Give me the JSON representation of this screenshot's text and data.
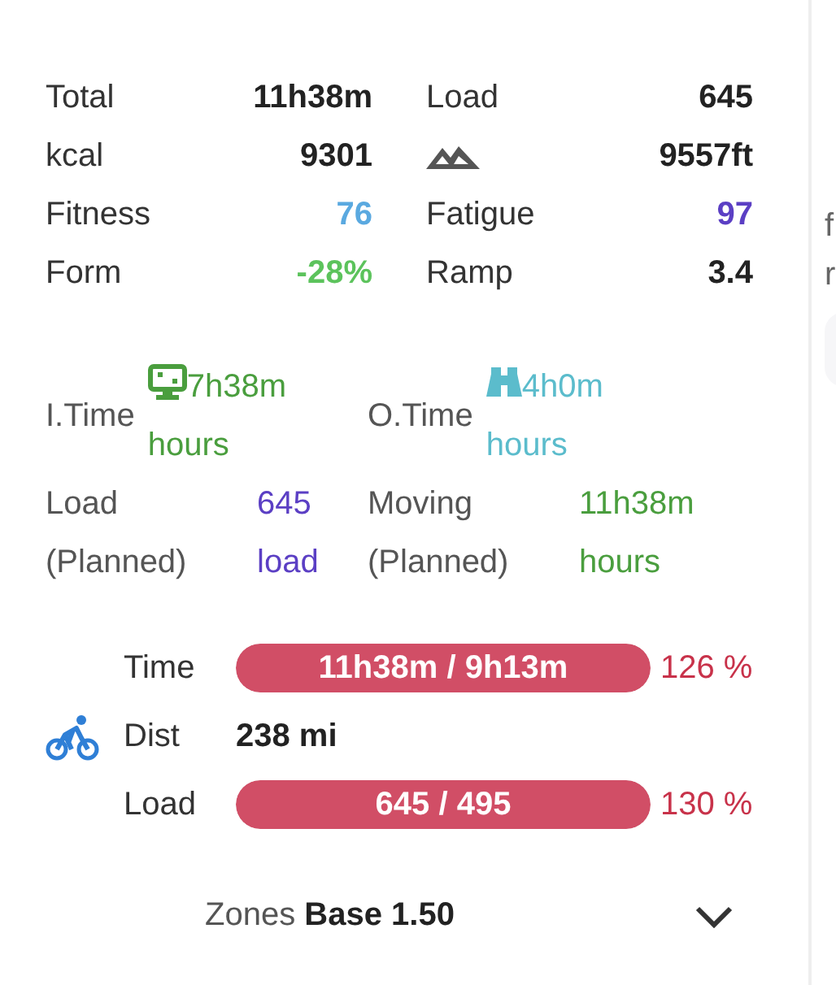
{
  "summary": [
    {
      "label": "Total",
      "kind": "text",
      "value": "11h38m"
    },
    {
      "label": "Load",
      "kind": "text",
      "value": "645"
    },
    {
      "label": "kcal",
      "kind": "text",
      "value": "9301"
    },
    {
      "kind": "elevation",
      "value": "9557ft"
    },
    {
      "label": "Fitness",
      "kind": "text",
      "value": "76",
      "color": "#5aa9e0"
    },
    {
      "label": "Fatigue",
      "kind": "text",
      "value": "97",
      "color": "#5b3fc4"
    },
    {
      "label": "Form",
      "kind": "text",
      "value": "-28%",
      "color": "#5cc35c"
    },
    {
      "label": "Ramp",
      "kind": "text",
      "value": "3.4"
    }
  ],
  "times": [
    {
      "label": "I.Time",
      "kind": "indoor",
      "value": "7h38m",
      "unit": "hours",
      "color": "#4a9e3e"
    },
    {
      "label": "O.Time",
      "kind": "outdoor",
      "value": "4h0m",
      "unit": "hours",
      "color": "#5bbccc"
    },
    {
      "label": "Load (Planned)",
      "kind": "plain",
      "value": "645",
      "unit": "load",
      "color": "#5b3fc4"
    },
    {
      "label": "Moving (Planned)",
      "kind": "plain",
      "value": "11h38m",
      "unit": "hours",
      "color": "#4a9e3e"
    }
  ],
  "plan": {
    "kind": "ride",
    "rows": [
      {
        "label": "Time",
        "kind": "bar",
        "text": "11h38m / 9h13m",
        "level": 1,
        "percent": "126 %"
      },
      {
        "label": "Dist",
        "kind": "text",
        "text": "238 mi"
      },
      {
        "label": "Load",
        "kind": "bar",
        "text": "645 / 495",
        "level": 1,
        "percent": "130 %"
      }
    ]
  },
  "zones": {
    "label": "Zones",
    "value": "Base 1.50",
    "expanded": false
  },
  "side_panel": {
    "texts": [
      "f",
      "r"
    ]
  }
}
